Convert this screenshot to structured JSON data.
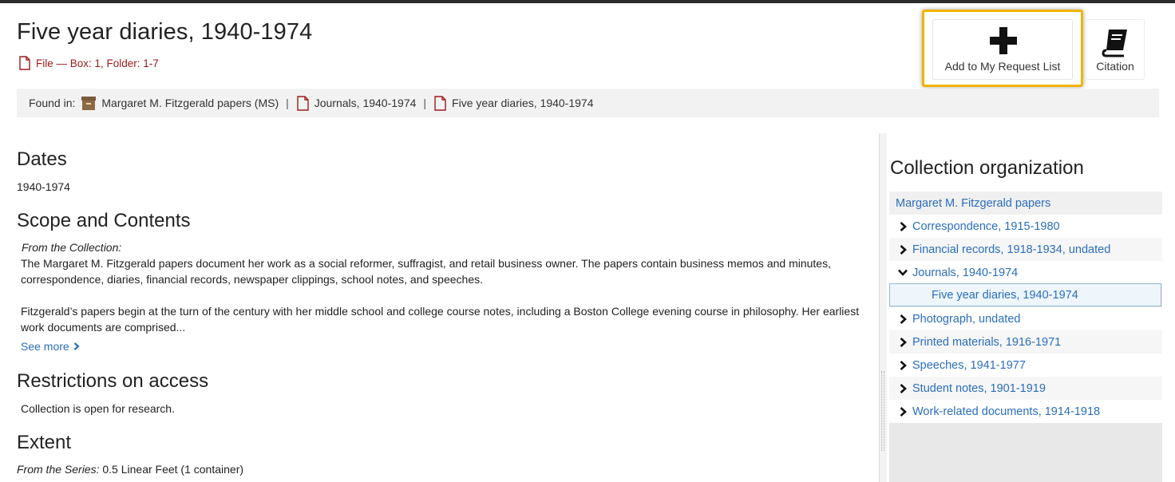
{
  "header": {
    "title": "Five year diaries, 1940-1974",
    "file_info": "File — Box: 1, Folder: 1-7"
  },
  "actions": {
    "request_label": "Add to My Request List",
    "citation_label": "Citation"
  },
  "found_in": {
    "label": "Found in:",
    "crumbs": [
      {
        "label": "Margaret M. Fitzgerald papers (MS)",
        "icon": "archive-box-icon"
      },
      {
        "label": "Journals, 1940-1974",
        "icon": "file-icon"
      },
      {
        "label": "Five year diaries, 1940-1974",
        "icon": "file-icon"
      }
    ],
    "separator": "|"
  },
  "sections": {
    "dates": {
      "heading": "Dates",
      "value": "1940-1974"
    },
    "scope": {
      "heading": "Scope and Contents",
      "source": "From the Collection:",
      "para1": "The Margaret M. Fitzgerald papers document her work as a social reformer, suffragist, and retail business owner. The papers contain business memos and minutes, correspondence, diaries, financial records, newspaper clippings, school notes, and speeches.",
      "para2": "Fitzgerald’s papers begin at the turn of the century with her middle school and college course notes, including a Boston College evening course in philosophy. Her earliest work documents are comprised...",
      "see_more": "See more"
    },
    "restrictions": {
      "heading": "Restrictions on access",
      "value": "Collection is open for research."
    },
    "extent": {
      "heading": "Extent",
      "source": "From the Series:",
      "value": "0.5 Linear Feet (1 container)"
    }
  },
  "collection_org": {
    "heading": "Collection organization",
    "root": "Margaret M. Fitzgerald papers",
    "items": [
      {
        "label": "Correspondence, 1915-1980",
        "expanded": false
      },
      {
        "label": "Financial records, 1918-1934, undated",
        "expanded": false
      },
      {
        "label": "Journals, 1940-1974",
        "expanded": true
      },
      {
        "label": "Five year diaries, 1940-1974",
        "current": true
      },
      {
        "label": "Photograph, undated",
        "expanded": false
      },
      {
        "label": "Printed materials, 1916-1971",
        "expanded": false
      },
      {
        "label": "Speeches, 1941-1977",
        "expanded": false
      },
      {
        "label": "Student notes, 1901-1919",
        "expanded": false
      },
      {
        "label": "Work-related documents, 1914-1918",
        "expanded": false
      }
    ]
  },
  "colors": {
    "link": "#2a6ebb",
    "file_red": "#9b1b1b",
    "highlight": "#f0b400"
  }
}
